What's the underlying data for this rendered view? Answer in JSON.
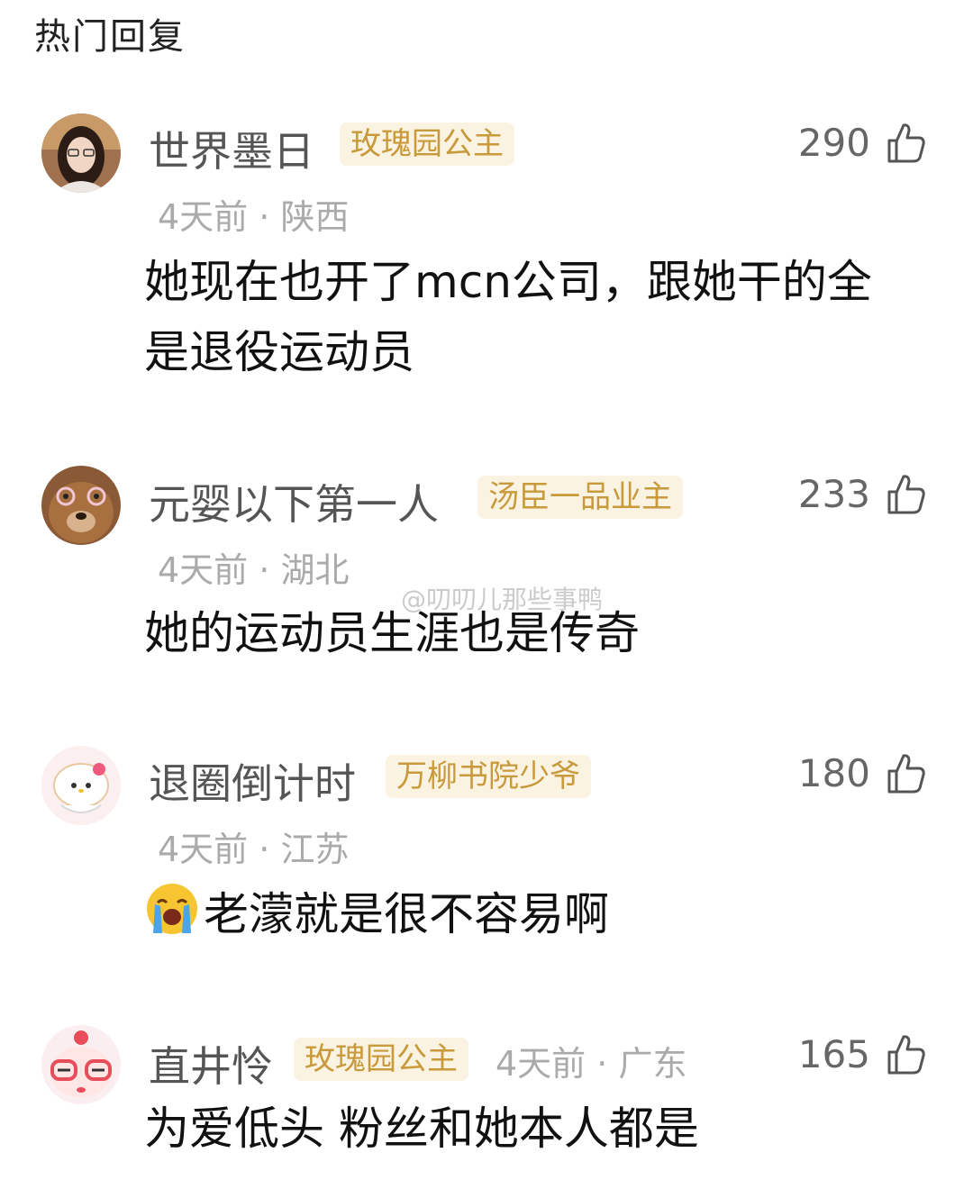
{
  "section_title": "热门回复",
  "watermark": "@叨叨儿那些事鸭",
  "comments": [
    {
      "username": "世界墨日",
      "badge": "玫瑰园公主",
      "time": "4天前",
      "location": "陕西",
      "likes": "290",
      "text_line1": "她现在也开了mcn公司，跟她干的全",
      "text_line2": "是退役运动员",
      "avatar_icon": "girl-photo-avatar"
    },
    {
      "username": "元婴以下第一人",
      "badge": "汤臣一品业主",
      "time": "4天前",
      "location": "湖北",
      "likes": "233",
      "text_line1": "她的运动员生涯也是传奇",
      "avatar_icon": "dog-with-glasses-avatar"
    },
    {
      "username": "退圈倒计时",
      "badge": "万柳书院少爷",
      "time": "4天前",
      "location": "江苏",
      "likes": "180",
      "text_line1": "老濛就是很不容易啊",
      "emoji": "crying-face-emoji",
      "avatar_icon": "hello-kitty-avatar"
    },
    {
      "username": "直井怜",
      "badge": "玫瑰园公主",
      "time": "4天前",
      "location": "广东",
      "likes": "165",
      "text_line1": "为爱低头 粉丝和她本人都是",
      "avatar_icon": "cartoon-glasses-avatar"
    }
  ],
  "separator": "·",
  "colors": {
    "badge_bg": "#fbf3e1",
    "badge_text": "#c89a3c",
    "meta_text": "#aaaaaa",
    "name_text": "#555555"
  }
}
